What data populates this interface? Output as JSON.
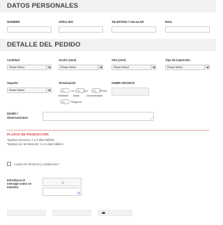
{
  "datos_personales": {
    "title": "DATOS PERSONALES",
    "fields": [
      {
        "label": "NOMBRE",
        "value": ""
      },
      {
        "label": "APELLIDO",
        "value": ""
      },
      {
        "label": "TELÉFONO / CELULAR",
        "value": ""
      },
      {
        "label": "MAIL",
        "value": ""
      }
    ]
  },
  "detalle_pedido": {
    "title": "DETALLE DEL PEDIDO",
    "selects": [
      {
        "label": "Cantidad",
        "value": "Please Select"
      },
      {
        "label": "Ancho (cms)",
        "value": "Please Select"
      },
      {
        "label": "Alto (cms)",
        "value": "Please Select"
      },
      {
        "label": "Tipo de impresión",
        "value": "Please Select"
      }
    ],
    "soporte": {
      "label": "Soporte",
      "value": "Please Select"
    },
    "terminacion": {
      "label": "Terminación",
      "options": [
        "Lа",
        "(La",
        "Punta",
        "Brillante",
        "Mate",
        "redondeadas",
        "Ninguna"
      ]
    },
    "subir_archivo": {
      "label": "SUBIR ARCHIVO"
    },
    "detalle": {
      "label_line1": "Detalle /",
      "label_line2": "Observaciones",
      "value": ""
    }
  },
  "plazos": {
    "title": "PLAZOS DE PRODUCCIÓN",
    "line1": "Tarjetas comunes: 2 a 3 días hábiles",
    "line2": "Tarjetas con terminación: 3 a 4 días hábiles"
  },
  "terms": {
    "text": "Acepto los términos y condiciones",
    "required_mark": "*",
    "checked": false
  },
  "captcha": {
    "line1": "Introduzca el",
    "line2": "mensaje como se",
    "line3": "muestra",
    "value": ""
  },
  "icons": {
    "select_caret": "chevron-down-icon",
    "refresh": "refresh-icon",
    "print": "printer-icon",
    "resize": "resize-grip-icon"
  }
}
